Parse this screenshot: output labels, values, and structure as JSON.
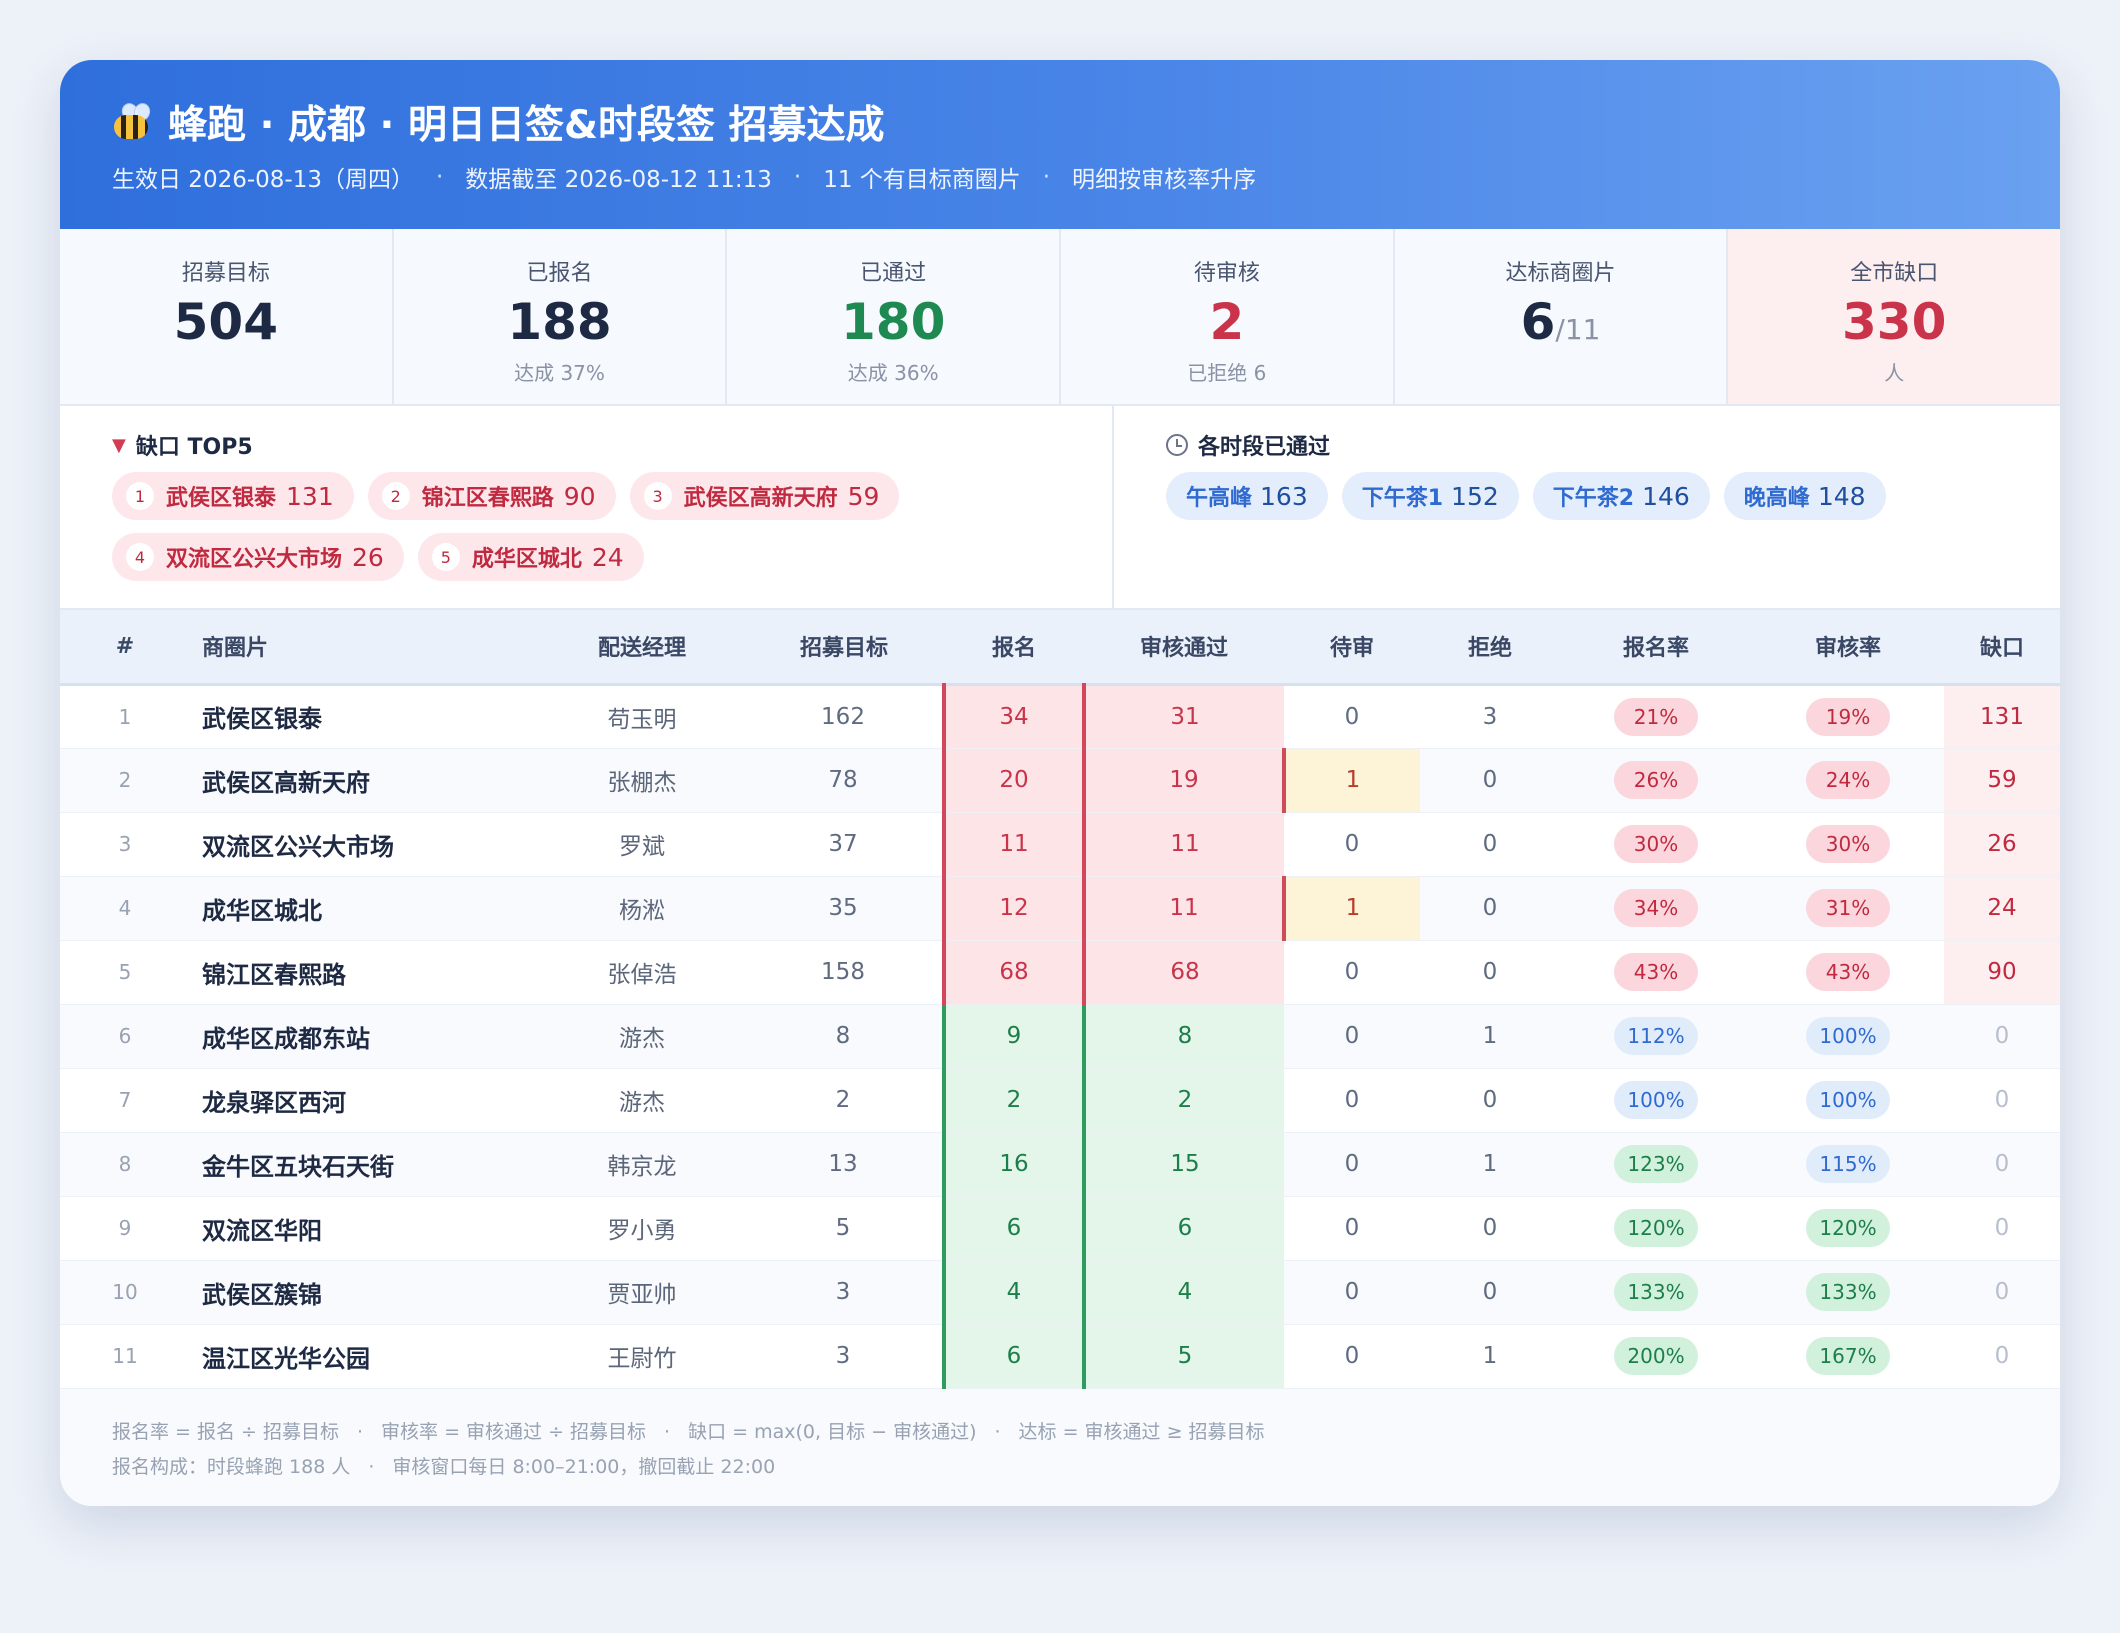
{
  "header": {
    "title": "蜂跑 · 成都 · 明日日签&时段签 招募达成",
    "effective": "生效日 2026-08-13（周四）",
    "data_as_of": "数据截至 2026-08-12 11:13",
    "areas": "11 个有目标商圈片",
    "sort_note": "明细按审核率升序",
    "sep": "·"
  },
  "kpis": [
    {
      "label": "招募目标",
      "value": "504",
      "sub": ""
    },
    {
      "label": "已报名",
      "value": "188",
      "sub": "达成 37%"
    },
    {
      "label": "已通过",
      "value": "180",
      "sub": "达成 36%"
    },
    {
      "label": "待审核",
      "value": "2",
      "sub": "已拒绝 6"
    },
    {
      "label": "达标商圈片",
      "value": "6",
      "den": "/11",
      "sub": ""
    },
    {
      "label": "全市缺口",
      "value": "330",
      "sub": "人"
    }
  ],
  "gap_top5": {
    "title": "缺口 TOP5",
    "items": [
      {
        "rank": "1",
        "name": "武侯区银泰",
        "count": "131"
      },
      {
        "rank": "2",
        "name": "锦江区春熙路",
        "count": "90"
      },
      {
        "rank": "3",
        "name": "武侯区高新天府",
        "count": "59"
      },
      {
        "rank": "4",
        "name": "双流区公兴大市场",
        "count": "26"
      },
      {
        "rank": "5",
        "name": "成华区城北",
        "count": "24"
      }
    ]
  },
  "slots": {
    "title": "各时段已通过",
    "items": [
      {
        "name": "午高峰",
        "count": "163"
      },
      {
        "name": "下午茶1",
        "count": "152"
      },
      {
        "name": "下午茶2",
        "count": "146"
      },
      {
        "name": "晚高峰",
        "count": "148"
      }
    ]
  },
  "table": {
    "headers": [
      "#",
      "商圈片",
      "配送经理",
      "招募目标",
      "报名",
      "审核通过",
      "待审",
      "拒绝",
      "报名率",
      "审核率",
      "缺口"
    ],
    "rows": [
      {
        "idx": "1",
        "name": "武侯区银泰",
        "mgr": "苟玉明",
        "target": "162",
        "signup": "34",
        "passed": "31",
        "pending": "0",
        "rejected": "3",
        "signup_rate": "21%",
        "pass_rate": "19%",
        "gap": "131"
      },
      {
        "idx": "2",
        "name": "武侯区高新天府",
        "mgr": "张棚杰",
        "target": "78",
        "signup": "20",
        "passed": "19",
        "pending": "1",
        "rejected": "0",
        "signup_rate": "26%",
        "pass_rate": "24%",
        "gap": "59"
      },
      {
        "idx": "3",
        "name": "双流区公兴大市场",
        "mgr": "罗斌",
        "target": "37",
        "signup": "11",
        "passed": "11",
        "pending": "0",
        "rejected": "0",
        "signup_rate": "30%",
        "pass_rate": "30%",
        "gap": "26"
      },
      {
        "idx": "4",
        "name": "成华区城北",
        "mgr": "杨淞",
        "target": "35",
        "signup": "12",
        "passed": "11",
        "pending": "1",
        "rejected": "0",
        "signup_rate": "34%",
        "pass_rate": "31%",
        "gap": "24"
      },
      {
        "idx": "5",
        "name": "锦江区春熙路",
        "mgr": "张倬浩",
        "target": "158",
        "signup": "68",
        "passed": "68",
        "pending": "0",
        "rejected": "0",
        "signup_rate": "43%",
        "pass_rate": "43%",
        "gap": "90"
      },
      {
        "idx": "6",
        "name": "成华区成都东站",
        "mgr": "游杰",
        "target": "8",
        "signup": "9",
        "passed": "8",
        "pending": "0",
        "rejected": "1",
        "signup_rate": "112%",
        "pass_rate": "100%",
        "gap": "0"
      },
      {
        "idx": "7",
        "name": "龙泉驿区西河",
        "mgr": "游杰",
        "target": "2",
        "signup": "2",
        "passed": "2",
        "pending": "0",
        "rejected": "0",
        "signup_rate": "100%",
        "pass_rate": "100%",
        "gap": "0"
      },
      {
        "idx": "8",
        "name": "金牛区五块石天街",
        "mgr": "韩京龙",
        "target": "13",
        "signup": "16",
        "passed": "15",
        "pending": "0",
        "rejected": "1",
        "signup_rate": "123%",
        "pass_rate": "115%",
        "gap": "0"
      },
      {
        "idx": "9",
        "name": "双流区华阳",
        "mgr": "罗小勇",
        "target": "5",
        "signup": "6",
        "passed": "6",
        "pending": "0",
        "rejected": "0",
        "signup_rate": "120%",
        "pass_rate": "120%",
        "gap": "0"
      },
      {
        "idx": "10",
        "name": "武侯区簇锦",
        "mgr": "贾亚帅",
        "target": "3",
        "signup": "4",
        "passed": "4",
        "pending": "0",
        "rejected": "0",
        "signup_rate": "133%",
        "pass_rate": "133%",
        "gap": "0"
      },
      {
        "idx": "11",
        "name": "温江区光华公园",
        "mgr": "王尉竹",
        "target": "3",
        "signup": "6",
        "passed": "5",
        "pending": "0",
        "rejected": "1",
        "signup_rate": "200%",
        "pass_rate": "167%",
        "gap": "0"
      }
    ]
  },
  "footer": {
    "line1": [
      "报名率 = 报名 ÷ 招募目标",
      "审核率 = 审核通过 ÷ 招募目标",
      "缺口 = max(0, 目标 − 审核通过)",
      "达标 = 审核通过 ≥ 招募目标"
    ],
    "line2": [
      "报名构成：时段蜂跑 188 人",
      "审核窗口每日 8:00–21:00，撤回截止 22:00"
    ]
  },
  "colors": {
    "header_start": "#2f6fdc",
    "header_end": "#6aa1f0",
    "bad": "#c9344a",
    "good": "#1e8a52",
    "accent": "#2f6ad0"
  }
}
